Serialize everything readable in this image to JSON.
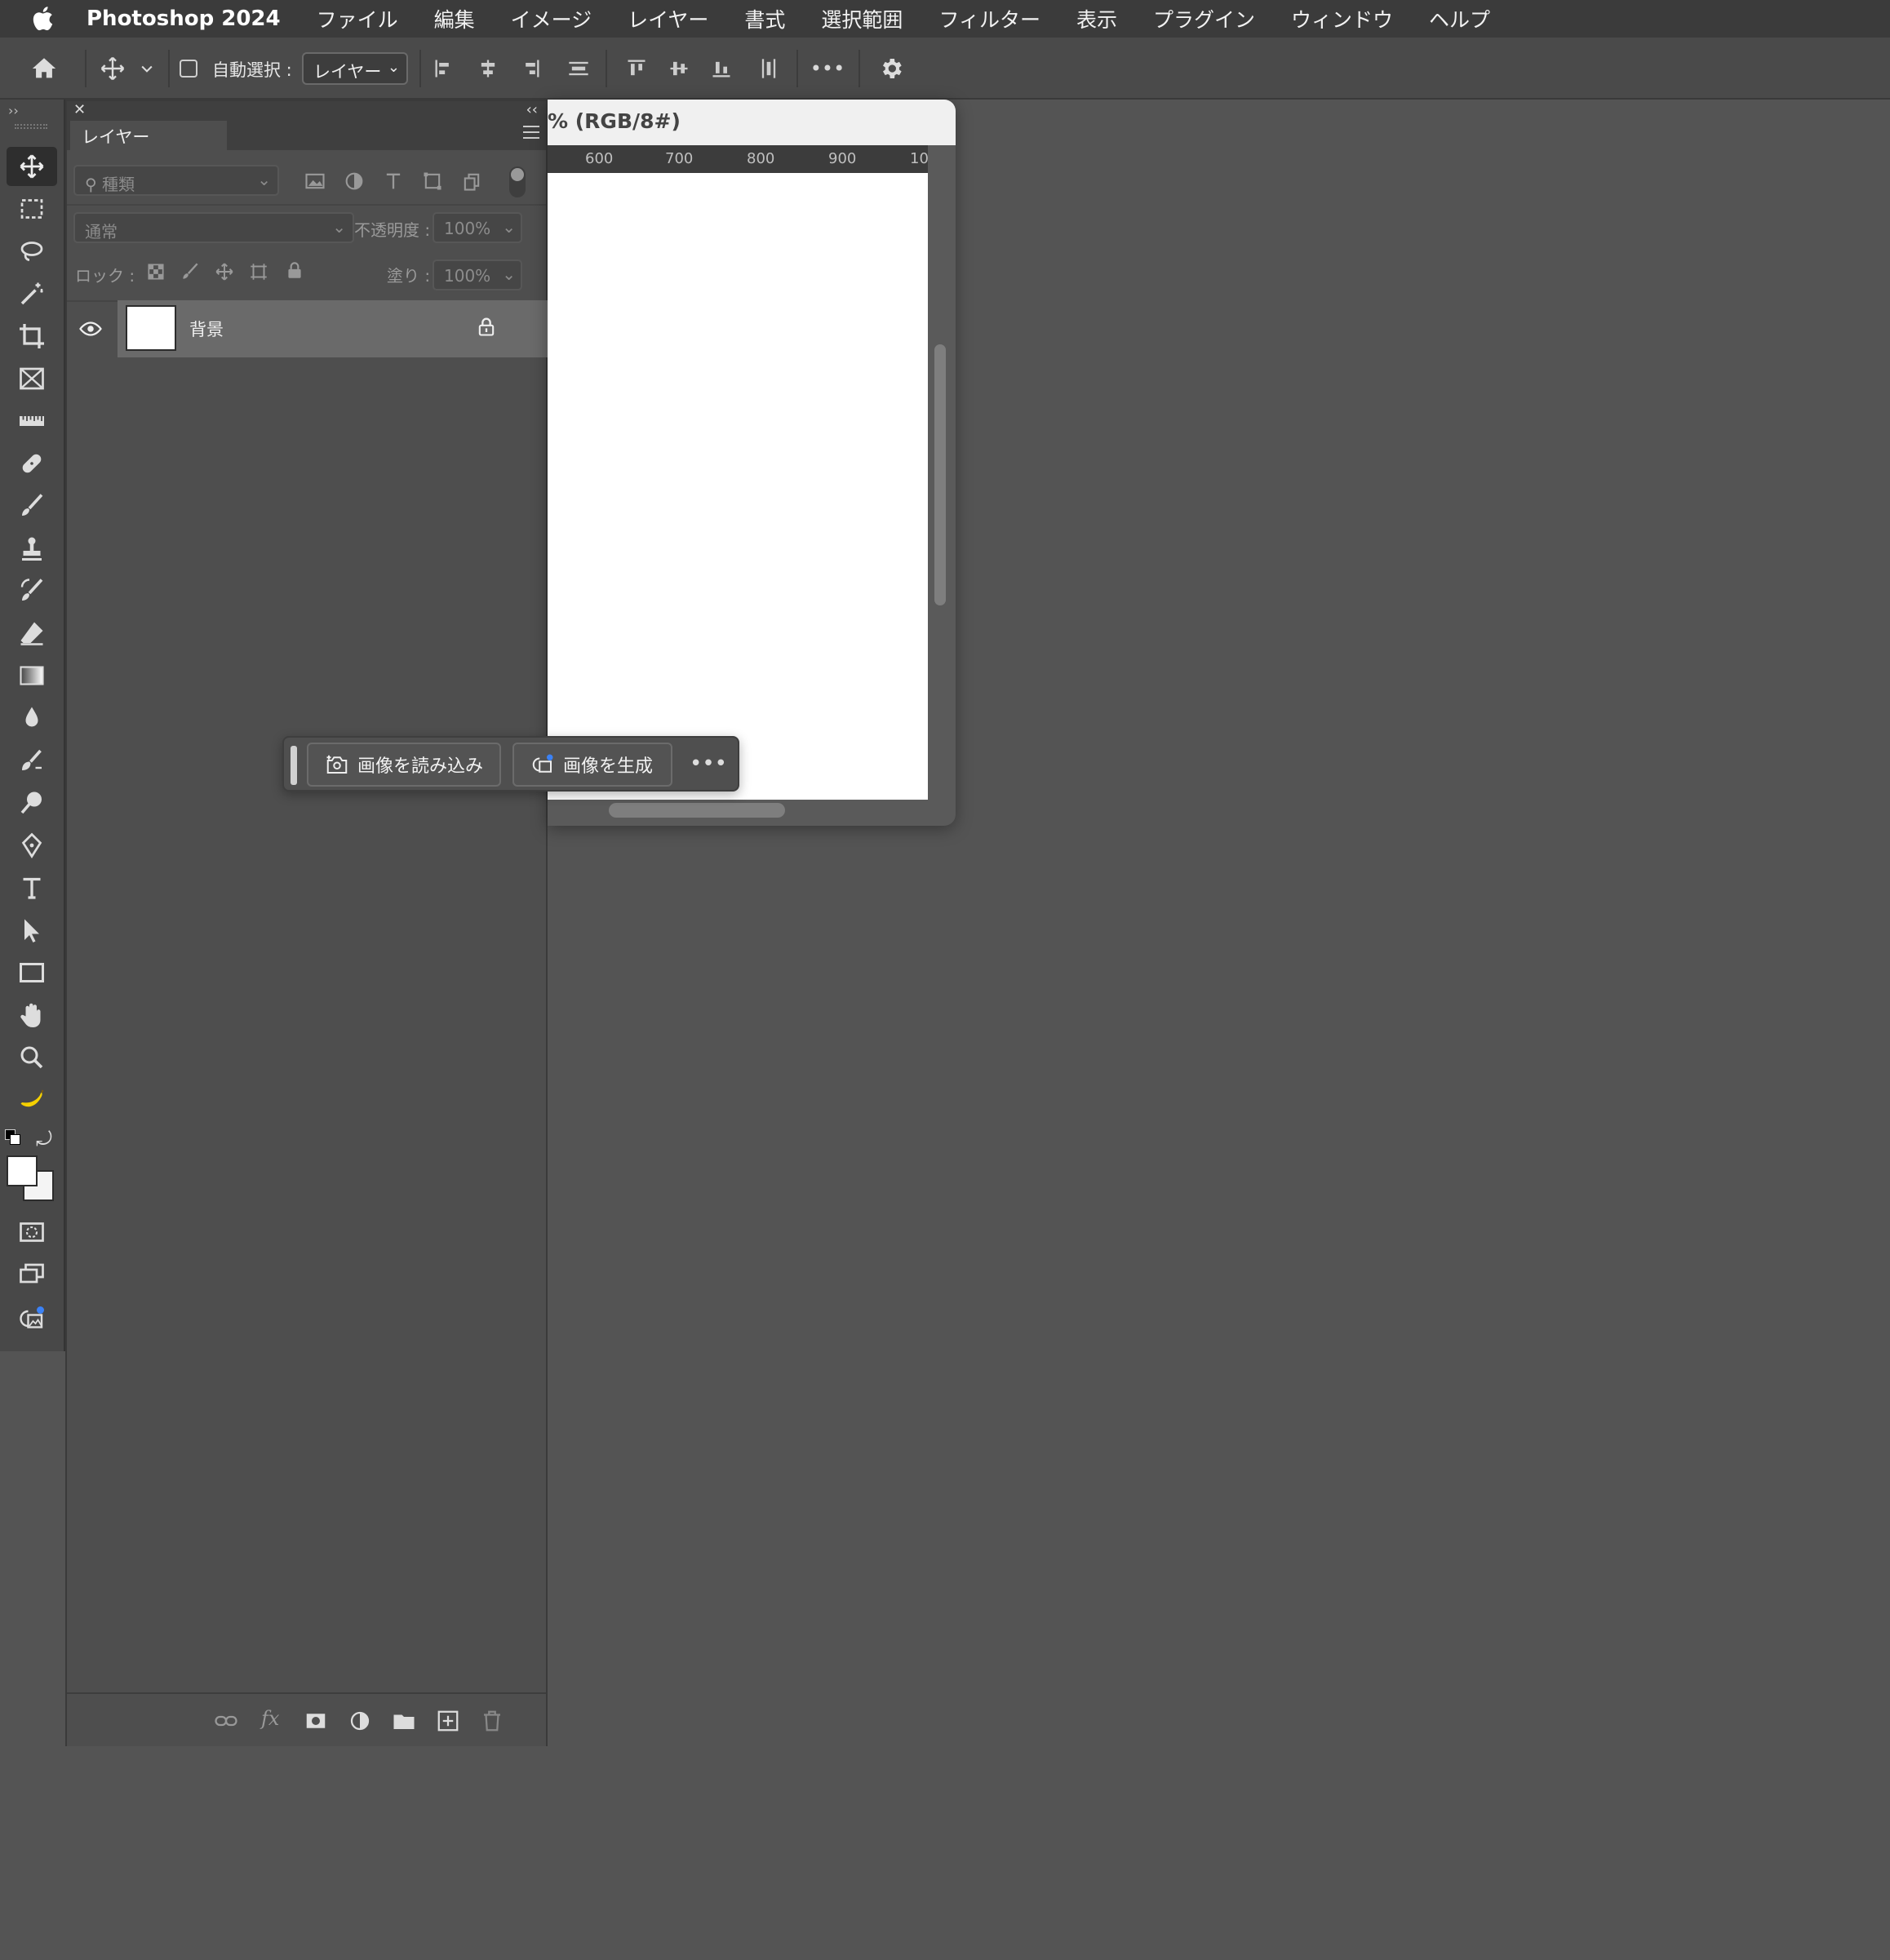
{
  "menubar": {
    "app_name": "Photoshop 2024",
    "items": [
      "ファイル",
      "編集",
      "イメージ",
      "レイヤー",
      "書式",
      "選択範囲",
      "フィルター",
      "表示",
      "プラグイン",
      "ウィンドウ",
      "ヘルプ"
    ]
  },
  "options_bar": {
    "auto_select_label": "自動選択 :",
    "target_value": "レイヤー"
  },
  "layers_panel": {
    "tab_label": "レイヤー",
    "filter_placeholder": "種類",
    "blend_mode": "通常",
    "opacity_label": "不透明度 :",
    "opacity_value": "100%",
    "lock_label": "ロック :",
    "fill_label": "塗り :",
    "fill_value": "100%",
    "layers": [
      {
        "name": "背景",
        "visible": true,
        "locked": true
      }
    ]
  },
  "document": {
    "title_fragment": "% (RGB/8#)",
    "ruler_ticks": [
      "600",
      "700",
      "800",
      "900",
      "10"
    ]
  },
  "taskbar": {
    "import_label": "画像を読み込み",
    "generate_label": "画像を生成",
    "more_label": "•••"
  },
  "colors": {
    "background": "#545454",
    "accent_dot": "#3b82f6",
    "banana": "#f5d000"
  }
}
